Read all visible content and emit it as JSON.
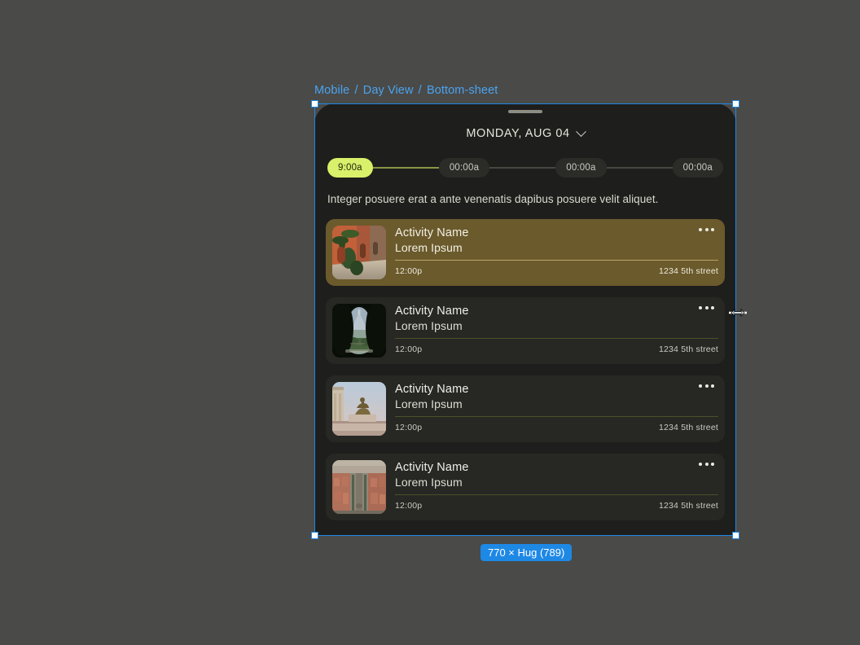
{
  "breadcrumb": {
    "parts": [
      "Mobile",
      "Day View",
      "Bottom-sheet"
    ],
    "separator": "/",
    "full": "Mobile / Day View / Bottom-sheet",
    "color": "#4aa3f0"
  },
  "selection": {
    "size_badge": "770 × Hug (789)",
    "badge_color": "#1e88e5",
    "cursor": "horizontal-resize-cursor"
  },
  "sheet": {
    "grabber": "drag-handle",
    "background": "#1e1e1c",
    "date": {
      "label": "MONDAY, AUG 04",
      "chevron": "chevron-down-icon"
    },
    "timeline": {
      "active_color": "#d8f06a",
      "steps": [
        {
          "label": "9:00a",
          "active": true
        },
        {
          "label": "00:00a",
          "active": false
        },
        {
          "label": "00:00a",
          "active": false
        },
        {
          "label": "00:00a",
          "active": false
        }
      ]
    },
    "description": "Integer posuere erat a ante venenatis dapibus posuere velit aliquet.",
    "cards": [
      {
        "title": "Activity Name",
        "subtitle": "Lorem Ipsum",
        "time": "12:00p",
        "address": "1234 5th street",
        "menu": "more-options-icon",
        "highlighted": true,
        "highlight_color": "#6b5a2c",
        "thumbnail": "mediterranean-alley-thumbnail"
      },
      {
        "title": "Activity Name",
        "subtitle": "Lorem Ipsum",
        "time": "12:00p",
        "address": "1234 5th street",
        "menu": "more-options-icon",
        "highlighted": false,
        "highlight_color": "#272724",
        "thumbnail": "keyhole-dome-view-thumbnail"
      },
      {
        "title": "Activity Name",
        "subtitle": "Lorem Ipsum",
        "time": "12:00p",
        "address": "1234 5th street",
        "menu": "more-options-icon",
        "highlighted": false,
        "highlight_color": "#272724",
        "thumbnail": "equestrian-monument-thumbnail"
      },
      {
        "title": "Activity Name",
        "subtitle": "Lorem Ipsum",
        "time": "12:00p",
        "address": "1234 5th street",
        "menu": "more-options-icon",
        "highlighted": false,
        "highlight_color": "#272724",
        "thumbnail": "aerial-boulevard-thumbnail"
      }
    ]
  }
}
